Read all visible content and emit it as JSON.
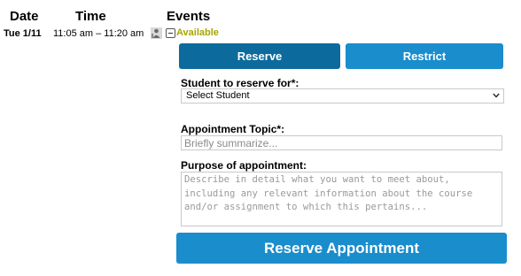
{
  "headers": {
    "date": "Date",
    "time": "Time",
    "events": "Events"
  },
  "row": {
    "date": "Tue 1/11",
    "time": "11:05 am – 11:20 am",
    "status": "Available",
    "status_color": "#a6a600"
  },
  "icons": {
    "person": "person-icon",
    "toggle": "collapse-toggle-icon",
    "chevron": "chevron-down-icon"
  },
  "buttons": {
    "reserve": "Reserve",
    "restrict": "Restrict",
    "reserve_appointment": "Reserve Appointment"
  },
  "form": {
    "student_label": "Student to reserve for*:",
    "student_selected": "Select Student",
    "topic_label": "Appointment Topic*:",
    "topic_placeholder": "Briefly summarize...",
    "purpose_label": "Purpose of appointment:",
    "purpose_placeholder": "Describe in detail what you want to meet about, including any relevant information about the course and/or assignment to which this pertains..."
  },
  "colors": {
    "reserve_button": "#0c6b9c",
    "restrict_button": "#1a8dcc",
    "primary_button": "#1a8dcc"
  }
}
